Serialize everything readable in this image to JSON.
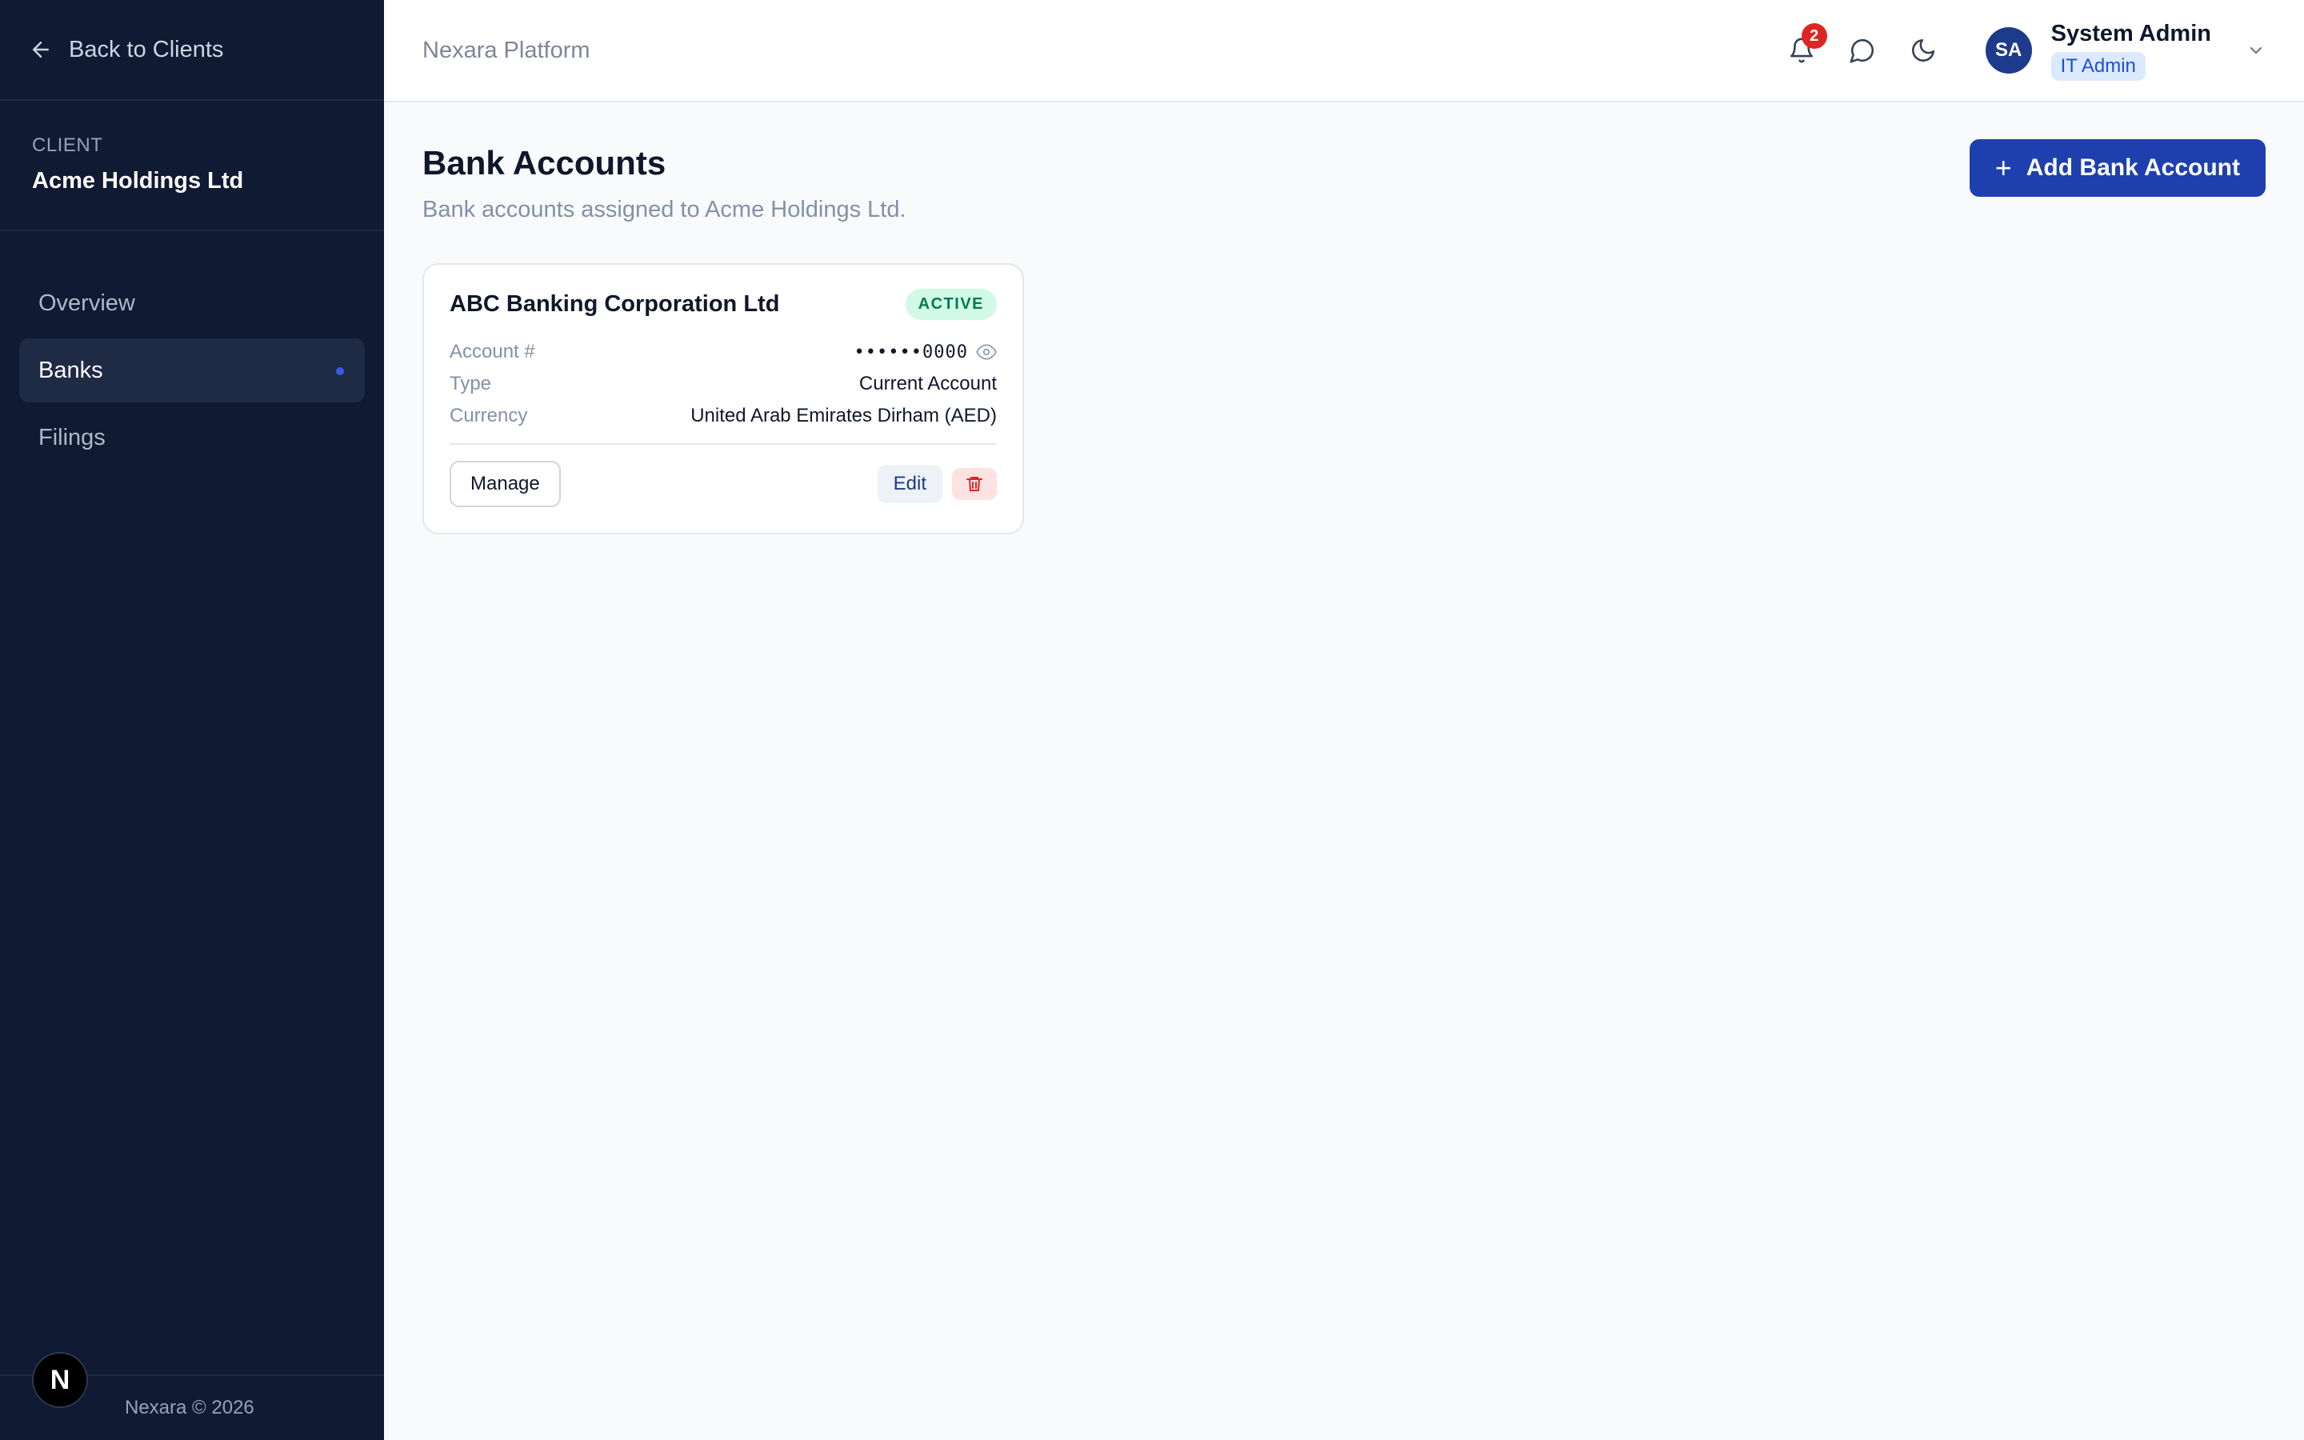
{
  "sidebar": {
    "back_label": "Back to Clients",
    "client_label": "CLIENT",
    "client_name": "Acme Holdings Ltd",
    "nav": [
      {
        "label": "Overview",
        "active": false
      },
      {
        "label": "Banks",
        "active": true
      },
      {
        "label": "Filings",
        "active": false
      }
    ],
    "footer": "Nexara © 2026",
    "badge_letter": "N"
  },
  "header": {
    "platform": "Nexara Platform",
    "notification_count": "2",
    "user": {
      "initials": "SA",
      "name": "System Admin",
      "role": "IT Admin"
    }
  },
  "page": {
    "title": "Bank Accounts",
    "subtitle": "Bank accounts assigned to Acme Holdings Ltd.",
    "add_button": "Add Bank Account"
  },
  "accounts": [
    {
      "bank": "ABC Banking Corporation Ltd",
      "status": "ACTIVE",
      "fields": [
        {
          "label": "Account #",
          "value": "••••••0000"
        },
        {
          "label": "Type",
          "value": "Current Account"
        },
        {
          "label": "Currency",
          "value": "United Arab Emirates Dirham (AED)"
        }
      ],
      "manage_label": "Manage",
      "edit_label": "Edit"
    }
  ],
  "colors": {
    "sidebar_bg": "#111a33",
    "accent": "#1e40af",
    "active_badge": "#047857",
    "danger": "#dc2626"
  }
}
